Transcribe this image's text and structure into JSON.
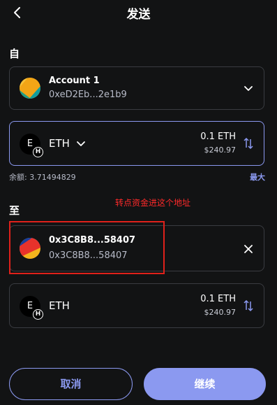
{
  "header": {
    "title": "发送",
    "back_icon": "chevron-left-icon"
  },
  "from": {
    "label": "自",
    "account_name": "Account 1",
    "account_address": "0xeD2Eb...2e1b9"
  },
  "from_token": {
    "symbol_initial": "E",
    "network_initial": "H",
    "symbol": "ETH",
    "amount": "0.1 ETH",
    "fiat": "$240.97",
    "swap_icon": "swap-vertical-icon"
  },
  "balance": {
    "text": "余额: 3.71494829",
    "max_label": "最大"
  },
  "annotation": {
    "text": "转点资金进这个地址"
  },
  "to": {
    "label": "至",
    "address_title": "0x3C8B8...58407",
    "address_sub": "0x3C8B8...58407",
    "close_icon": "close-icon"
  },
  "to_token": {
    "symbol_initial": "E",
    "network_initial": "H",
    "symbol": "ETH",
    "amount": "0.1 ETH",
    "fiat": "$240.97"
  },
  "footer": {
    "cancel_label": "取消",
    "continue_label": "继续"
  },
  "colors": {
    "background": "#121314",
    "accent": "#8b99f0",
    "annotation_red": "#e0211b"
  }
}
